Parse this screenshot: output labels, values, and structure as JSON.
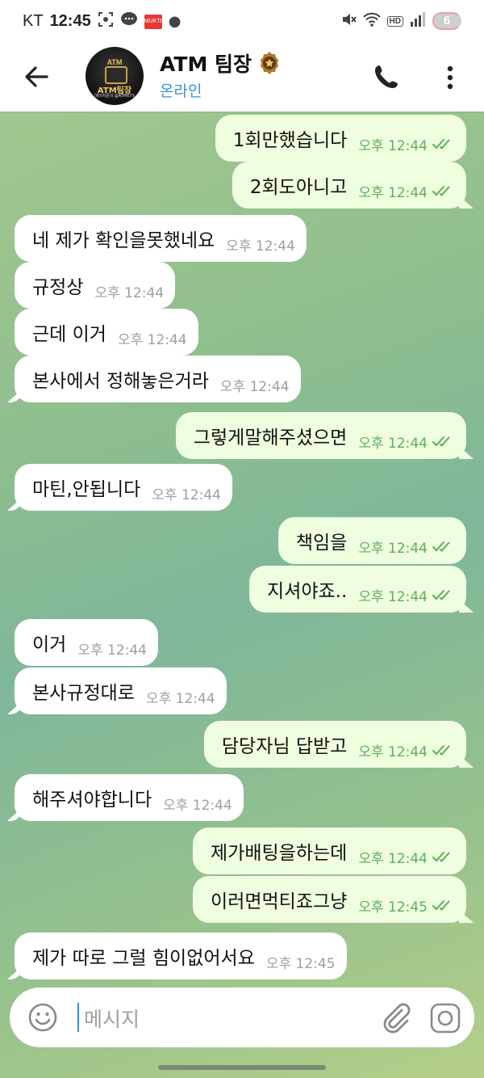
{
  "status_bar": {
    "carrier": "KT",
    "time": "12:45",
    "notif_app_label": "MUKTO",
    "hd": "HD",
    "battery_count": "6"
  },
  "header": {
    "title": "ATM 팀장",
    "status": "온라인",
    "avatar": {
      "top": "ATM",
      "name": "ATM팀장",
      "sub": "메이저문의 @ATM679"
    }
  },
  "messages": [
    {
      "dir": "out",
      "text": "1회만했습니다",
      "time": "오후 12:44",
      "read": true
    },
    {
      "dir": "out",
      "text": "2회도아니고",
      "time": "오후 12:44",
      "read": true
    },
    {
      "dir": "in",
      "text": "네 제가 확인을못했네요",
      "time": "오후 12:44"
    },
    {
      "dir": "in",
      "text": "규정상",
      "time": "오후 12:44"
    },
    {
      "dir": "in",
      "text": "근데 이거",
      "time": "오후 12:44"
    },
    {
      "dir": "in",
      "text": "본사에서 정해놓은거라",
      "time": "오후 12:44"
    },
    {
      "dir": "out",
      "text": "그렇게말해주셨으면",
      "time": "오후 12:44",
      "read": true
    },
    {
      "dir": "in",
      "text": "마틴,안됩니다",
      "time": "오후 12:44"
    },
    {
      "dir": "out",
      "text": "책임을",
      "time": "오후 12:44",
      "read": true
    },
    {
      "dir": "out",
      "text": "지셔야죠..",
      "time": "오후 12:44",
      "read": true
    },
    {
      "dir": "in",
      "text": "이거",
      "time": "오후 12:44"
    },
    {
      "dir": "in",
      "text": "본사규정대로",
      "time": "오후 12:44"
    },
    {
      "dir": "out",
      "text": "담당자님 답받고",
      "time": "오후 12:44",
      "read": true
    },
    {
      "dir": "in",
      "text": "해주셔야합니다",
      "time": "오후 12:44"
    },
    {
      "dir": "out",
      "text": "제가배팅을하는데",
      "time": "오후 12:44",
      "read": true
    },
    {
      "dir": "out",
      "text": "이러면먹티죠그냥",
      "time": "오후 12:45",
      "read": true
    },
    {
      "dir": "in",
      "text": "제가 따로 그럴 힘이없어서요",
      "time": "오후 12:45"
    }
  ],
  "input": {
    "placeholder": "메시지"
  },
  "colors": {
    "accent": "#3a8fd6",
    "outgoing_bubble": "#eefedf",
    "read_ticks": "#5fae5a"
  }
}
